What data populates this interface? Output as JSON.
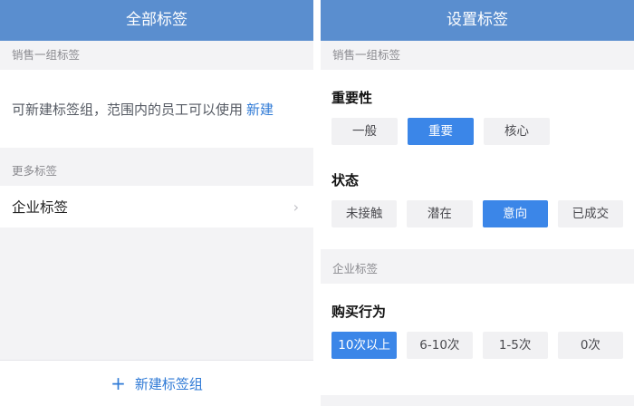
{
  "left": {
    "title": "全部标签",
    "section1_header": "销售一组标签",
    "info_text": "可新建标签组，范围内的员工可以使用",
    "info_link": "新建",
    "section2_header": "更多标签",
    "row_label": "企业标签",
    "row_chevron": "›",
    "bottom_plus": "+",
    "bottom_label": "新建标签组"
  },
  "right": {
    "title": "设置标签",
    "section1_header": "销售一组标签",
    "groups1": [
      {
        "title": "重要性",
        "chips": [
          "一般",
          "重要",
          "核心"
        ],
        "selected": 1
      },
      {
        "title": "状态",
        "chips": [
          "未接触",
          "潜在",
          "意向",
          "已成交"
        ],
        "selected": 2
      }
    ],
    "section2_header": "企业标签",
    "groups2": [
      {
        "title": "购买行为",
        "chips": [
          "10次以上",
          "6-10次",
          "1-5次",
          "0次"
        ],
        "selected": 0
      }
    ]
  },
  "colors": {
    "titlebar": "#5a8ecf",
    "accent": "#3b86e8",
    "link": "#2f7ad6"
  },
  "icons": {
    "chevron": "chevron-right-icon",
    "plus": "plus-icon"
  }
}
